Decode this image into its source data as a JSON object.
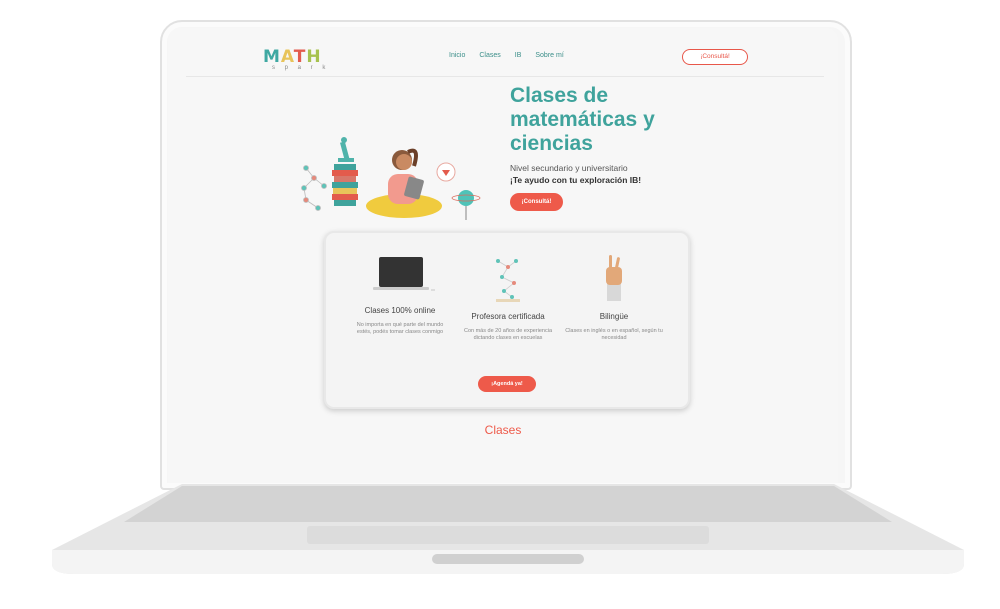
{
  "logo": {
    "letters": [
      "M",
      "A",
      "T",
      "H"
    ],
    "subtitle": "s p a r k"
  },
  "nav": {
    "items": [
      "Inicio",
      "Clases",
      "IB",
      "Sobre mí"
    ],
    "cta": "¡Consultá!"
  },
  "hero": {
    "title": "Clases de matemáticas y ciencias",
    "subtitle": "Nivel secundario y universitario",
    "tagline": "¡Te ayudo con tu exploración IB!",
    "cta": "¡Consultá!"
  },
  "features": [
    {
      "title": "Clases 100% online",
      "desc": "No importa en qué parte del mundo estés, podés tomar clases conmigo",
      "icon": "laptop-icon"
    },
    {
      "title": "Profesora certificada",
      "desc": "Con más de 20 años de experiencia dictando clases en escuelas",
      "icon": "molecule-icon"
    },
    {
      "title": "Bilingüe",
      "desc": "Clases en inglés o en español, según tu necesidad",
      "icon": "hand-icon"
    }
  ],
  "features_cta": "¡Agendá ya!",
  "section_title": "Clases",
  "colors": {
    "teal": "#3fa39c",
    "coral": "#ee5a4a",
    "background": "#f7f7f7"
  }
}
